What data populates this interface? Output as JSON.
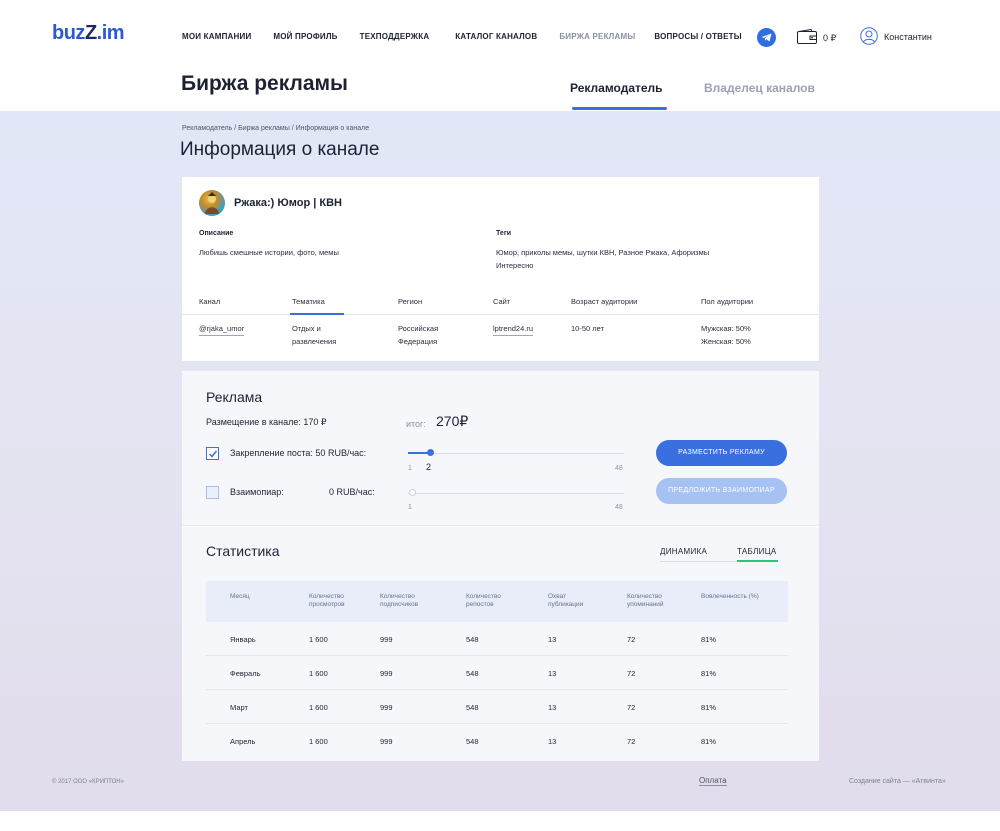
{
  "logo": {
    "text_a": "buz",
    "text_z": "Z",
    "text_b": ".im"
  },
  "nav": [
    {
      "label": "МОИ КАМПАНИИ"
    },
    {
      "label": "МОЙ ПРОФИЛЬ"
    },
    {
      "label": "ТЕХПОДДЕРЖКА"
    },
    {
      "label": "КАТАЛОГ КАНАЛОВ"
    },
    {
      "label": "БИРЖА РЕКЛАМЫ"
    },
    {
      "label": "ВОПРОСЫ / ОТВЕТЫ"
    }
  ],
  "header": {
    "balance": "0 ₽",
    "username": "Константин",
    "icons": [
      "telegram-icon",
      "wallet-icon",
      "user-icon"
    ]
  },
  "page": {
    "title": "Биржа рекламы",
    "tab_active": "Рекламодатель",
    "tab_inactive": "Владелец каналов"
  },
  "breadcrumb": "Рекламодатель / Биржа рекламы / Информация о канале",
  "section_title": "Информация о канале",
  "channel": {
    "name": "Ржака:) Юмор | КВН",
    "description_label": "Описание",
    "description": "Любишь смешные истории, фото, мемы",
    "tags_label": "Теги",
    "tags_line1": "Юмор, приколы мемы, шутки КВН, Разное Ржака, Афоризмы",
    "tags_line2": "Интересно",
    "columns": [
      "Канал",
      "Тематика",
      "Регион",
      "Сайт",
      "Возраст аудитории",
      "Пол аудитории"
    ],
    "values": {
      "channel": "@rjaka_umor",
      "topic_1": "Отдых и",
      "topic_2": "развлечения",
      "region_1": "Российская",
      "region_2": "Федерация",
      "site": "lptrend24.ru",
      "age": "10-50 лет",
      "gender_1": "Мужская: 50%",
      "gender_2": "Женская: 50%"
    }
  },
  "ad": {
    "title": "Реклама",
    "placement": "Размещение в канале: 170 ₽",
    "total_label": "итог:",
    "total_value": "270₽",
    "pin_label": "Закрепление поста: 50 RUB/час:",
    "pin_checked": true,
    "pin_slider": {
      "min": "1",
      "max": "48",
      "value": "2"
    },
    "mutual_label": "Взаимопиар:",
    "mutual_price": "0 RUB/час:",
    "mutual_checked": false,
    "mutual_slider": {
      "min": "1",
      "max": "48"
    },
    "btn_place": "РАЗМЕСТИТЬ РЕКЛАМУ",
    "btn_offer": "ПРЕДЛОЖИТЬ ВЗАИМОПИАР"
  },
  "stats": {
    "title": "Статистика",
    "tab_dynamics": "ДИНАМИКА",
    "tab_table": "ТАБЛИЦА",
    "headers": [
      [
        "Месяц",
        ""
      ],
      [
        "Количество",
        "просмотров"
      ],
      [
        "Количество",
        "подписчиков"
      ],
      [
        "Количество",
        "репостов"
      ],
      [
        "Охват",
        "публикации"
      ],
      [
        "Количество",
        "упоминаний"
      ],
      [
        "Вовлеченность (%)",
        ""
      ]
    ],
    "rows": [
      [
        "Январь",
        "1 600",
        "999",
        "548",
        "13",
        "72",
        "81%"
      ],
      [
        "Февраль",
        "1 600",
        "999",
        "548",
        "13",
        "72",
        "81%"
      ],
      [
        "Март",
        "1 600",
        "999",
        "548",
        "13",
        "72",
        "81%"
      ],
      [
        "Апрель",
        "1 600",
        "999",
        "548",
        "13",
        "72",
        "81%"
      ]
    ]
  },
  "footer": {
    "copyright": "© 2017 ООО «КРИПТОН»",
    "payment": "Оплата",
    "credits": "Создание сайта — «Атвинта»"
  },
  "colors": {
    "accent": "#3a6fe0",
    "green": "#2dc57a",
    "text": "#1d2233",
    "muted": "#8a90a6"
  }
}
